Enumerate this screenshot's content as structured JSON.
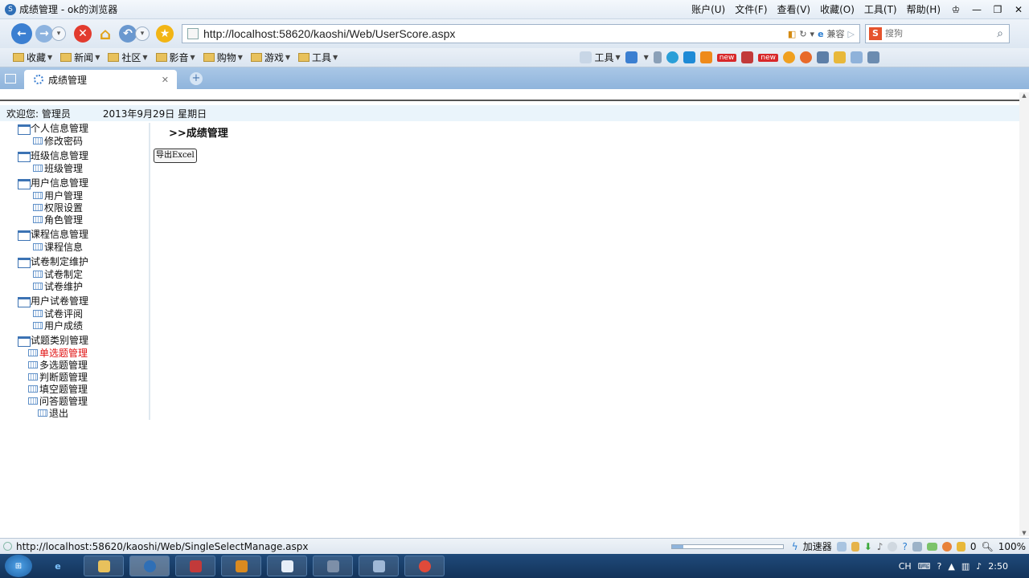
{
  "window": {
    "title": "成绩管理 - ok的浏览器",
    "menus": [
      "账户(U)",
      "文件(F)",
      "查看(V)",
      "收藏(O)",
      "工具(T)",
      "帮助(H)"
    ]
  },
  "nav": {
    "url": "http://localhost:58620/kaoshi/Web/UserScore.aspx",
    "compat_label": "兼容",
    "search_placeholder": "搜狗"
  },
  "favorites": {
    "items": [
      "收藏",
      "新闻",
      "社区",
      "影音",
      "购物",
      "游戏",
      "工具"
    ],
    "tools_label": "工具",
    "new_badge": "new"
  },
  "tabs": {
    "active_label": "成绩管理"
  },
  "page": {
    "welcome": "欢迎您: 管理员",
    "date": "2013年9月29日 星期日",
    "heading": ">>成绩管理",
    "export_button": "导出Excel",
    "tree": [
      {
        "label": "个人信息管理",
        "children": [
          "修改密码"
        ]
      },
      {
        "label": "班级信息管理",
        "children": [
          "班级管理"
        ]
      },
      {
        "label": "用户信息管理",
        "children": [
          "用户管理",
          "权限设置",
          "角色管理"
        ]
      },
      {
        "label": "课程信息管理",
        "children": [
          "课程信息"
        ]
      },
      {
        "label": "试卷制定维护",
        "children": [
          "试卷制定",
          "试卷维护"
        ]
      },
      {
        "label": "用户试卷管理",
        "children": [
          "试卷评阅",
          "用户成绩"
        ]
      },
      {
        "label": "试题类别管理",
        "children": [
          "单选题管理",
          "多选题管理",
          "判断题管理",
          "填空题管理",
          "问答题管理"
        ]
      }
    ],
    "logout": "退出",
    "hovered_item": "单选题管理"
  },
  "status": {
    "url": "http://localhost:58620/kaoshi/Web/SingleSelectManage.aspx",
    "accelerator": "加速器",
    "download_count": "0",
    "zoom": "100%"
  },
  "taskbar": {
    "lang": "CH",
    "time": "2:50"
  }
}
